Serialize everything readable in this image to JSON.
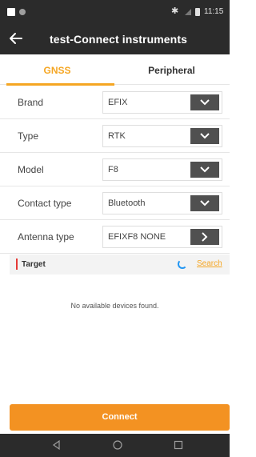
{
  "status_bar": {
    "time": "11:15",
    "bluetooth_icon": "bluetooth-icon",
    "battery_icon": "battery-icon"
  },
  "app_bar": {
    "title": "test-Connect instruments",
    "back_icon": "arrow-left-icon"
  },
  "tabs": [
    {
      "label": "GNSS",
      "active": true
    },
    {
      "label": "Peripheral",
      "active": false
    }
  ],
  "fields": [
    {
      "label": "Brand",
      "value": "EFIX",
      "control": "chevron-down-icon"
    },
    {
      "label": "Type",
      "value": "RTK",
      "control": "chevron-down-icon"
    },
    {
      "label": "Model",
      "value": "F8",
      "control": "chevron-down-icon"
    },
    {
      "label": "Contact type",
      "value": "Bluetooth",
      "control": "chevron-down-icon"
    },
    {
      "label": "Antenna type",
      "value": "EFIXF8 NONE",
      "control": "chevron-right-icon"
    }
  ],
  "target": {
    "label": "Target",
    "search_label": "Search",
    "empty_message": "No available devices found."
  },
  "connect_button": {
    "label": "Connect"
  },
  "colors": {
    "accent": "#f39222",
    "header": "#2b2b2b",
    "control_button": "#505050",
    "target_marker": "#e53935",
    "spinner": "#2196f3"
  }
}
